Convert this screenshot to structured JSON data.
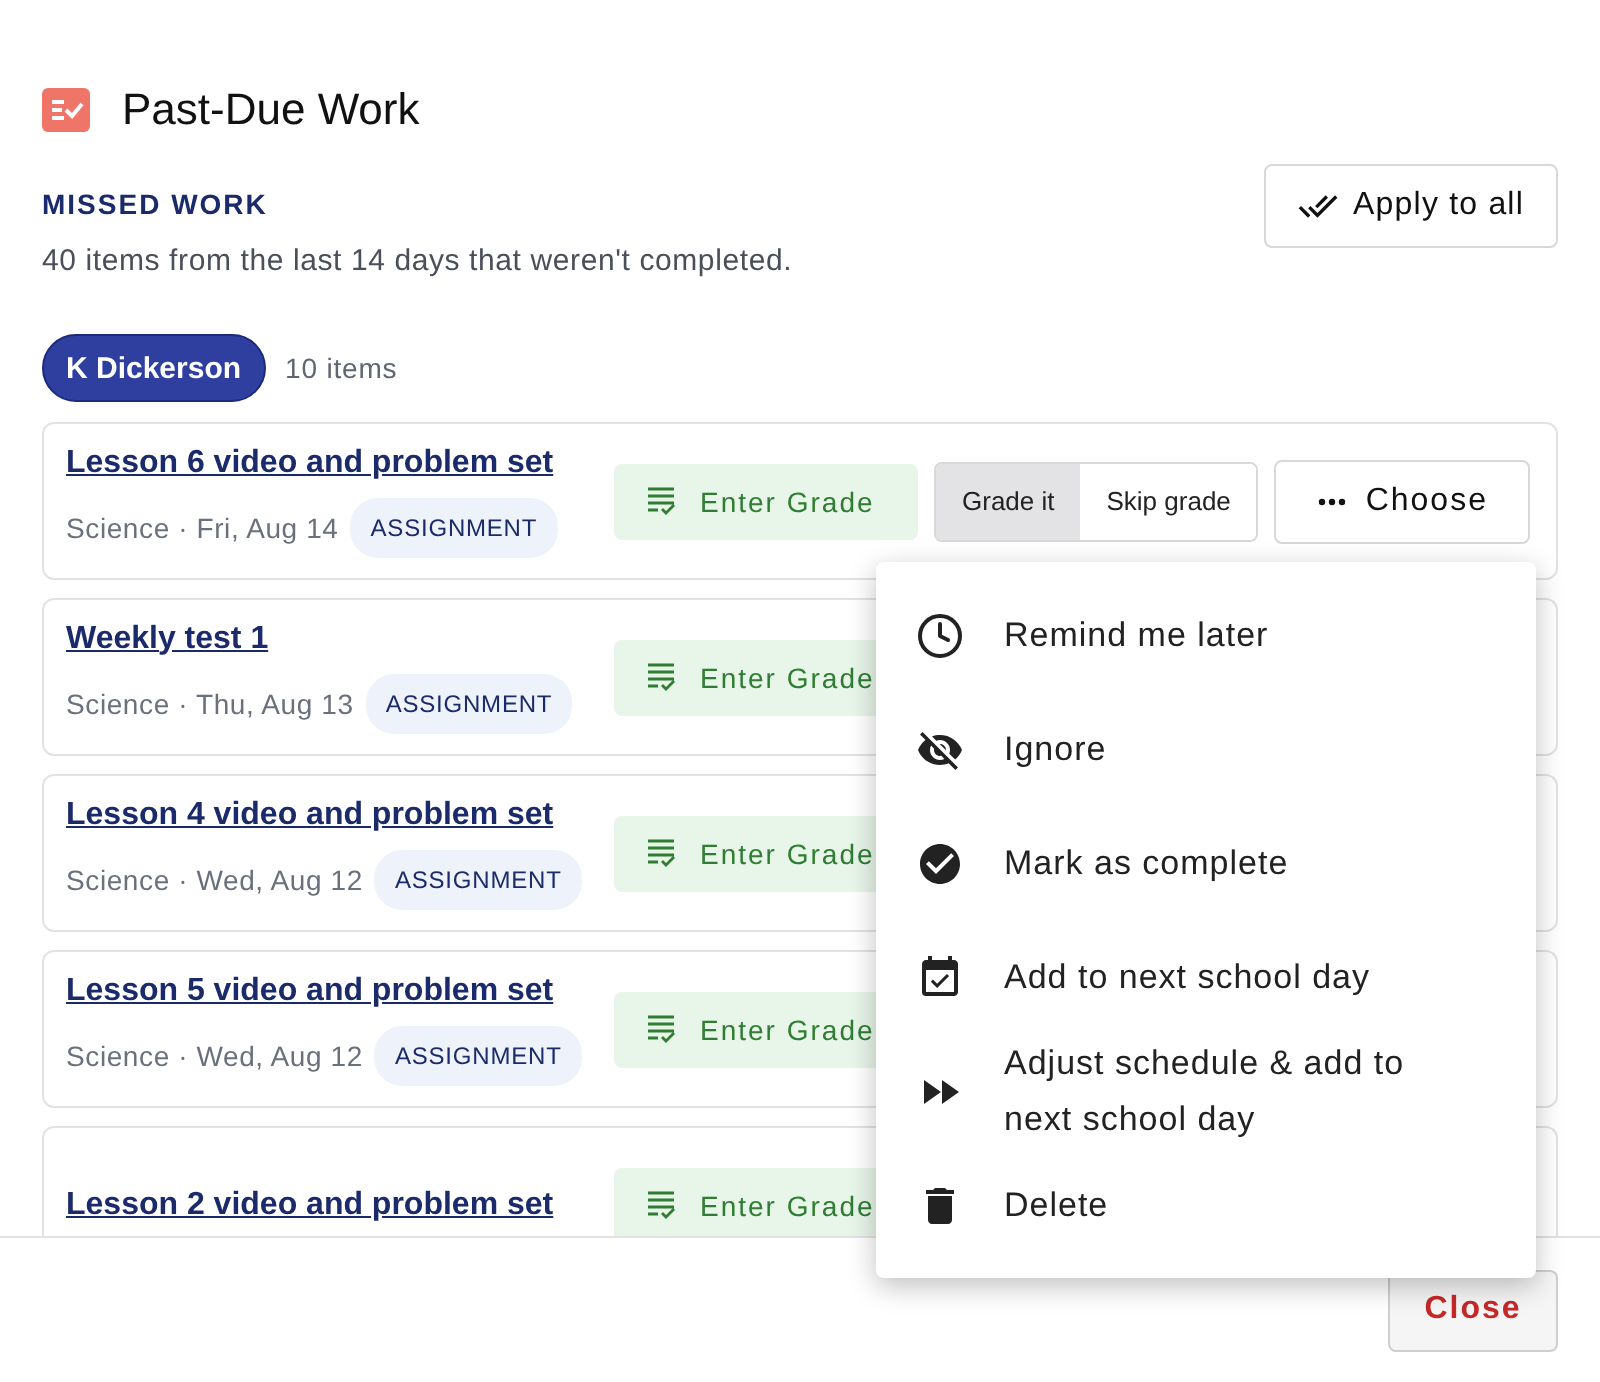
{
  "header": {
    "title": "Past-Due Work"
  },
  "section": {
    "heading": "MISSED WORK",
    "description": "40 items from the last 14 days that weren't completed.",
    "apply_button": "Apply to all"
  },
  "student": {
    "name": "K Dickerson",
    "count": "10 items"
  },
  "items": [
    {
      "title": "Lesson 6 video and problem set",
      "meta": "Science · Fri, Aug 14",
      "tag": "ASSIGNMENT",
      "enter_grade": "Enter Grade",
      "grade_options": [
        {
          "label": "Grade it",
          "selected": true
        },
        {
          "label": "Skip grade",
          "selected": false
        }
      ],
      "choose": "Choose"
    },
    {
      "title": "Weekly test 1",
      "meta": "Science · Thu, Aug 13",
      "tag": "ASSIGNMENT",
      "enter_grade": "Enter Grade"
    },
    {
      "title": "Lesson 4 video and problem set",
      "meta": "Science · Wed, Aug 12",
      "tag": "ASSIGNMENT",
      "enter_grade": "Enter Grade"
    },
    {
      "title": "Lesson 5 video and problem set",
      "meta": "Science · Wed, Aug 12",
      "tag": "ASSIGNMENT",
      "enter_grade": "Enter Grade"
    },
    {
      "title": "Lesson 2 video and problem set",
      "enter_grade": "Enter Grade"
    }
  ],
  "menu": [
    {
      "kind": "clock",
      "label": "Remind me later"
    },
    {
      "kind": "ignore",
      "label": "Ignore"
    },
    {
      "kind": "complete",
      "label": "Mark as complete"
    },
    {
      "kind": "calendar",
      "label": "Add to next school day"
    },
    {
      "kind": "forward",
      "label": "Adjust schedule & add to next school day"
    },
    {
      "kind": "delete",
      "label": "Delete"
    }
  ],
  "footer": {
    "close_button": "Close"
  }
}
